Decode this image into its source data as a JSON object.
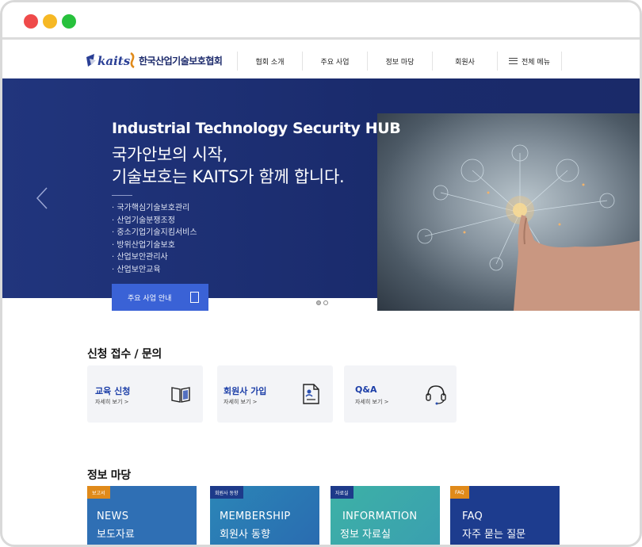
{
  "header": {
    "logo_text": "한국산업기술보호협회",
    "logo_mark": "kaits",
    "nav": [
      "협회 소개",
      "주요 사업",
      "정보 마당",
      "회원사"
    ],
    "all_menu": "전체 메뉴"
  },
  "hero": {
    "title": "Industrial Technology Security HUB",
    "subtitle_line1": "국가안보의 시작,",
    "subtitle_line2": "기술보호는 KAITS가 함께 합니다.",
    "items": [
      "국가핵심기술보호관리",
      "산업기술분쟁조정",
      "중소기업기술지킴서비스",
      "방위산업기술보호",
      "산업보안관리사",
      "산업보안교육"
    ],
    "button": "주요 사업 안내"
  },
  "apply": {
    "title": "신청 접수 / 문의",
    "cards": [
      {
        "title": "교육 신청",
        "sub": "자세히 보기 >",
        "icon": "book-icon"
      },
      {
        "title": "회원사 가입",
        "sub": "자세히 보기 >",
        "icon": "document-icon"
      },
      {
        "title": "Q&A",
        "sub": "자세히 보기 >",
        "icon": "headset-icon"
      }
    ]
  },
  "info": {
    "title": "정보 마당",
    "tiles": [
      {
        "tag": "보고서",
        "en": "NEWS",
        "ko": "보도자료",
        "bg": "#2f6fb4",
        "tag_bg": "#e08a1a"
      },
      {
        "tag": "회원사 동향",
        "en": "MEMBERSHIP",
        "ko": "회원사 동향",
        "bg": "#2b86b7",
        "tag_bg": "#1d3a8a"
      },
      {
        "tag": "자료실",
        "en": "INFORMATION",
        "ko": "정보 자료실",
        "bg": "#3db1a6",
        "tag_bg": "#1d3a8a"
      },
      {
        "tag": "FAQ",
        "en": "FAQ",
        "ko": "자주 묻는 질문",
        "bg": "#1d3c8e",
        "tag_bg": "#e08a1a"
      }
    ]
  }
}
